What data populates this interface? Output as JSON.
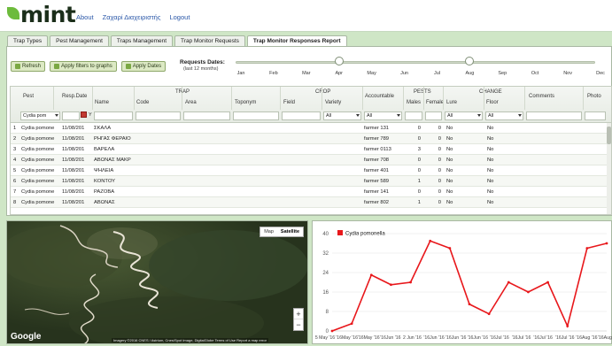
{
  "header": {
    "logo_text": "mint",
    "nav": [
      "About",
      "Ζαχαρί Διαχειριστής",
      "Logout"
    ]
  },
  "tabs": [
    {
      "label": "Trap Types",
      "active": false
    },
    {
      "label": "Pest Management",
      "active": false
    },
    {
      "label": "Traps Management",
      "active": false
    },
    {
      "label": "Trap Monitor Requests",
      "active": false
    },
    {
      "label": "Trap Monitor Responses Report",
      "active": true
    }
  ],
  "toolbar": {
    "refresh": "Refresh",
    "apply_graphs": "Apply filters to graphs",
    "apply_dates": "Apply Dates"
  },
  "requests_dates": {
    "label": "Requests Dates:",
    "sub": "(last 12 months)",
    "months": [
      "Jan",
      "Feb",
      "Mar",
      "Apr",
      "May",
      "Jun",
      "Jul",
      "Aug",
      "Sep",
      "Oct",
      "Nov",
      "Dec"
    ],
    "range_start_month": "Apr",
    "range_end_month": "Aug"
  },
  "grid": {
    "groups": {
      "trap": "TRAP",
      "crop": "CROP",
      "pests": "PESTS",
      "change": "CHANGE"
    },
    "columns": {
      "pest": "Pest",
      "resp_date": "Resp.Date",
      "name": "Name",
      "code": "Code",
      "area": "Area",
      "toponym": "Toponym",
      "field": "Field",
      "variety": "Variety",
      "accountable": "Accountable",
      "males": "Males",
      "females": "Female",
      "lure": "Lure",
      "floor": "Floor",
      "comments": "Comments",
      "photo": "Photo"
    },
    "filters": {
      "pest": "Cydia pom",
      "date_op": "Y",
      "variety": "All",
      "accountable": "All",
      "lure": "All",
      "floor": "All"
    },
    "rows": [
      {
        "n": "1",
        "pest": "Cydia pomone",
        "date": "11/08/201",
        "name": "ΣΚΑΛΑ",
        "acc": "farmer 131",
        "males": "0",
        "females": "0",
        "lure": "No",
        "floor": "No"
      },
      {
        "n": "2",
        "pest": "Cydia pomone",
        "date": "11/08/201",
        "name": "ΡΗΓΑΣ ΦΕΡΑΙΟ",
        "acc": "farmer 789",
        "males": "0",
        "females": "0",
        "lure": "No",
        "floor": "No"
      },
      {
        "n": "3",
        "pest": "Cydia pomone",
        "date": "11/08/201",
        "name": "ΒΑΡΕΛΑ",
        "acc": "farmer 0113",
        "males": "3",
        "females": "0",
        "lure": "No",
        "floor": "No"
      },
      {
        "n": "4",
        "pest": "Cydia pomone",
        "date": "11/08/201",
        "name": "ΑΒΩΝΑΣ ΜΑΚΡ",
        "acc": "farmer 708",
        "males": "0",
        "females": "0",
        "lure": "No",
        "floor": "No"
      },
      {
        "n": "5",
        "pest": "Cydia pomone",
        "date": "11/08/201",
        "name": "ΨΗΛΕΙΑ",
        "acc": "farmer 401",
        "males": "0",
        "females": "0",
        "lure": "No",
        "floor": "No"
      },
      {
        "n": "6",
        "pest": "Cydia pomone",
        "date": "11/08/201",
        "name": "ΚΟΝΤΟΥ",
        "acc": "farmer 589",
        "males": "1",
        "females": "0",
        "lure": "No",
        "floor": "No"
      },
      {
        "n": "7",
        "pest": "Cydia pomone",
        "date": "11/08/201",
        "name": "ΡΑΖΟΒΑ",
        "acc": "farmer 141",
        "males": "0",
        "females": "0",
        "lure": "No",
        "floor": "No"
      },
      {
        "n": "8",
        "pest": "Cydia pomone",
        "date": "11/08/201",
        "name": "ΑΒΩΝΑΣ",
        "acc": "farmer 802",
        "males": "1",
        "females": "0",
        "lure": "No",
        "floor": "No"
      }
    ]
  },
  "map": {
    "map_label": "Map",
    "satellite_label": "Satellite",
    "zoom_in": "+",
    "zoom_out": "−",
    "google": "Google",
    "attribution": "Imagery ©2016 CNES / Astrium, Cnes/Spot Image, DigitalGlobe    Terms of Use    Report a map error"
  },
  "chart_data": {
    "type": "line",
    "series": [
      {
        "name": "Cydia pomonella",
        "color": "#e8171b",
        "values": [
          0,
          3,
          23,
          19,
          20,
          37,
          34,
          11,
          7,
          20,
          16,
          20,
          2,
          34,
          36
        ]
      }
    ],
    "x": [
      "5 May '16",
      "12 May '16",
      "19 May '16",
      "26 May '16",
      "2 Jun '16",
      "9 Jun '16",
      "16 Jun '16",
      "23 Jun '16",
      "30 Jun '16",
      "7 Jul '16",
      "14 Jul '16",
      "21 Jul '16",
      "28 Jul '16",
      "4 Aug '16",
      "11 Aug '16"
    ],
    "x_tick_labels": [
      "5 May '16",
      "'16May '16",
      "'16May '16",
      "'16Jun '16",
      "2 Jun '16",
      "'16Jun '16",
      "'16Jun '16",
      "'16Jun '16",
      "'16Jul '16",
      "'16Jul '16",
      "'16Jul '16",
      "'16Jul '16",
      "'16Aug '16",
      "'16Aug '16"
    ],
    "yticks": [
      0,
      8,
      16,
      24,
      32,
      40
    ],
    "ylim": [
      0,
      40
    ],
    "grid": true,
    "legend": "top-left"
  }
}
